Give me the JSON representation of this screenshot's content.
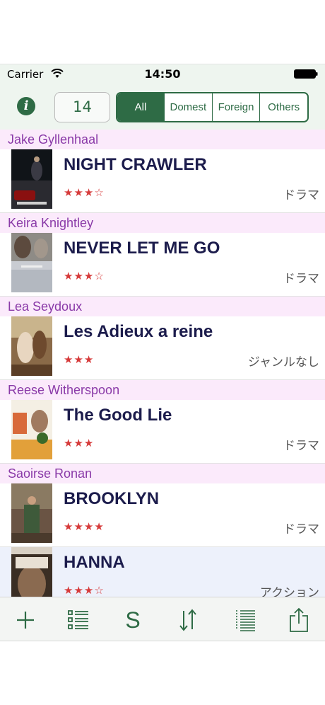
{
  "status_bar": {
    "carrier": "Carrier",
    "time": "14:50"
  },
  "toolbar": {
    "info_icon": "info-icon",
    "count": "14",
    "segments": [
      "All",
      "Domest",
      "Foreign",
      "Others"
    ],
    "selected_segment": "All",
    "accent_color": "#2e6b45"
  },
  "list": {
    "sections": [
      {
        "header": "Jake Gyllenhaal",
        "title": "NIGHT CRAWLER",
        "rating": "★★★☆",
        "genre": "ドラマ"
      },
      {
        "header": "Keira Knightley",
        "title": "NEVER LET ME GO",
        "rating": "★★★☆",
        "genre": "ドラマ"
      },
      {
        "header": "Lea Seydoux",
        "title": "Les Adieux a reine",
        "rating": "★★★",
        "genre": "ジャンルなし"
      },
      {
        "header": "Reese Witherspoon",
        "title": "The Good Lie",
        "rating": "★★★",
        "genre": "ドラマ"
      },
      {
        "header": "Saoirse Ronan",
        "title": "BROOKLYN",
        "rating": "★★★★",
        "genre": "ドラマ"
      }
    ],
    "extra_row": {
      "title": "HANNA",
      "rating": "★★★☆",
      "genre": "アクション"
    }
  },
  "bottom_bar": {
    "icons": [
      "add-icon",
      "list-icon",
      "sort-by-s-icon",
      "sort-icon",
      "numbered-list-icon",
      "share-icon"
    ],
    "s_label": "S"
  }
}
